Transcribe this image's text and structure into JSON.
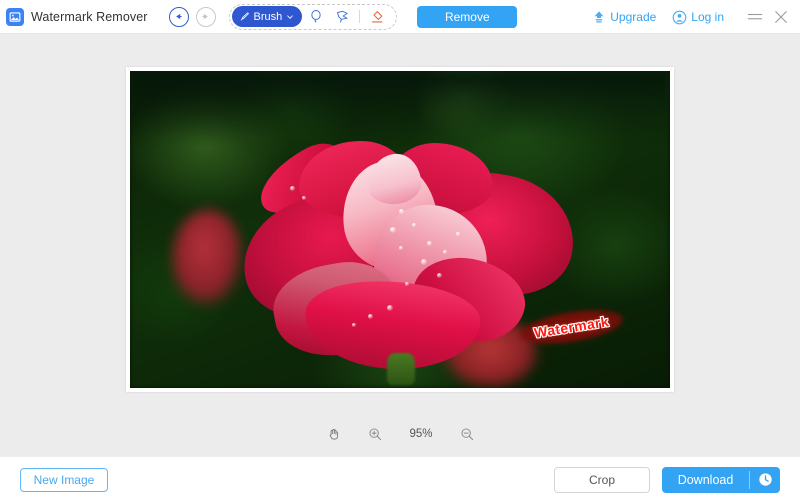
{
  "app": {
    "title": "Watermark Remover",
    "logo_icon": "image-logo-icon"
  },
  "header": {
    "undo_icon": "undo-arrow-icon",
    "redo_icon": "redo-arrow-icon",
    "tools": {
      "brush_label": "Brush",
      "brush_icon": "brush-icon",
      "brush_chevron": "chevron-down-icon",
      "lasso_icon": "lasso-icon",
      "polygon_icon": "polygonal-lasso-icon",
      "eraser_icon": "eraser-icon"
    },
    "remove_label": "Remove",
    "upgrade_label": "Upgrade",
    "upgrade_icon": "upgrade-arrow-icon",
    "login_label": "Log in",
    "login_icon": "user-account-icon",
    "menu_icon": "hamburger-menu-icon",
    "close_icon": "close-icon"
  },
  "canvas": {
    "image_alt": "red-rose-photo",
    "watermark_text": "Watermark",
    "zoom": {
      "pan_icon": "hand-pan-icon",
      "zoom_in_icon": "zoom-in-icon",
      "level": "95%",
      "zoom_out_icon": "zoom-out-icon"
    }
  },
  "footer": {
    "new_image_label": "New Image",
    "crop_label": "Crop",
    "download_label": "Download",
    "download_icon": "history-clock-icon"
  },
  "colors": {
    "accent_blue": "#33a3f4",
    "brush_blue": "#2f57cf",
    "eraser_orange": "#e8663a",
    "canvas_gray": "#ececec",
    "watermark_red": "#ff1a10"
  }
}
